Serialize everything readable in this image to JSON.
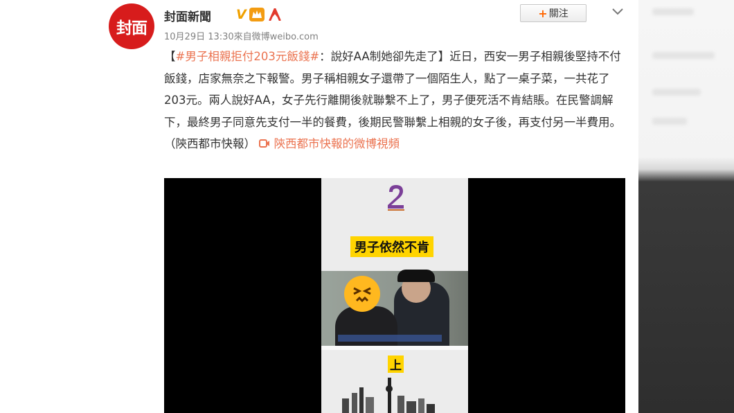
{
  "account": {
    "avatar_text": "封面",
    "name": "封面新聞",
    "verified_badge": "V"
  },
  "post_meta": "10月29日 13:30來自微博weibo.com",
  "follow_button": {
    "plus": "+",
    "label": "關注"
  },
  "post": {
    "open_bracket": "【",
    "hashtag": "#男子相親拒付203元飯錢#",
    "headline_rest": "：說好AA制她卻先走了】",
    "body": "近日，西安一男子相親後堅持不付飯錢，店家無奈之下報警。男子稱相親女子還帶了一個陌生人，點了一桌子菜，一共花了203元。兩人說好AA，女子先行離開後就聯繫不上了，男子便死活不肯結賬。在民警調解下，最終男子同意先支付一半的餐費，後期民警聯繫上相親的女子後，再支付另一半費用。（陝西都市快報）",
    "video_link": "陝西都市快報的微博視頻"
  },
  "video": {
    "caption": "男子依然不肯",
    "next_caption": "上"
  },
  "colors": {
    "accent": "#eb7350",
    "avatar_red": "#d71c1c",
    "caption_yellow": "#ffd400"
  },
  "icons": [
    "chevron-down-icon",
    "video-link-icon",
    "crown-badge-icon",
    "person-badge-icon"
  ]
}
